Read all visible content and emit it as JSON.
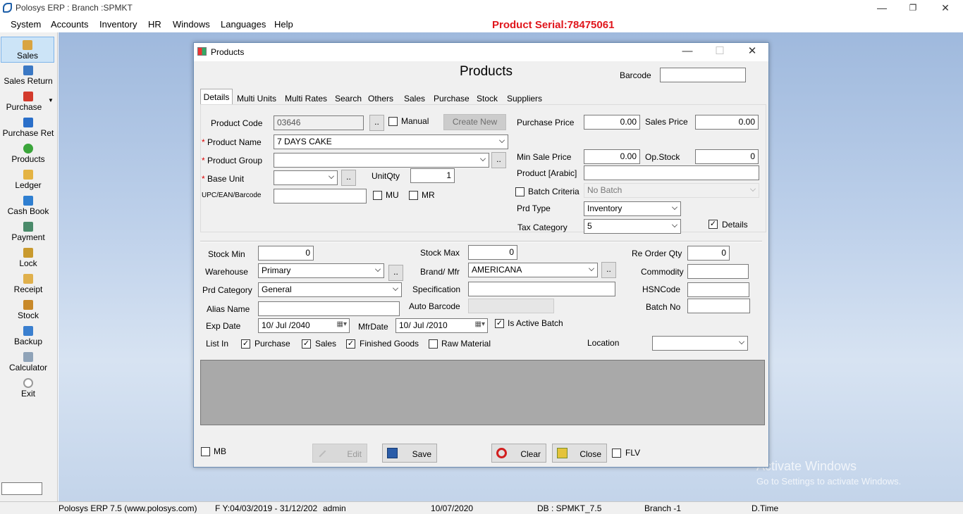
{
  "app": {
    "title": "Polosys ERP :  Branch :SPMKT",
    "serial": "Product Serial:78475061"
  },
  "menu": [
    "System",
    "Accounts",
    "Inventory",
    "HR",
    "Windows",
    "Languages",
    "Help"
  ],
  "sidebar": [
    {
      "label": "Sales",
      "icon": "sales-icon",
      "color": "#d9a441"
    },
    {
      "label": "Sales Return",
      "icon": "sales-return-icon",
      "color": "#3b78c4"
    },
    {
      "label": "Purchase",
      "icon": "purchase-icon",
      "color": "#d33a2c"
    },
    {
      "label": "Purchase Ret",
      "icon": "purchase-return-icon",
      "color": "#2a6fc9"
    },
    {
      "label": "Products",
      "icon": "products-icon",
      "color": "#3aa53a"
    },
    {
      "label": "Ledger",
      "icon": "ledger-icon",
      "color": "#e4b343"
    },
    {
      "label": "Cash Book",
      "icon": "cash-book-icon",
      "color": "#2f7fd1"
    },
    {
      "label": "Payment",
      "icon": "payment-icon",
      "color": "#4a8a6a"
    },
    {
      "label": "Lock",
      "icon": "lock-icon",
      "color": "#c99a2e"
    },
    {
      "label": "Receipt",
      "icon": "receipt-icon",
      "color": "#e0b04c"
    },
    {
      "label": "Stock",
      "icon": "stock-icon",
      "color": "#c8892a"
    },
    {
      "label": "Backup",
      "icon": "backup-icon",
      "color": "#3a7fcf"
    },
    {
      "label": "Calculator",
      "icon": "calculator-icon",
      "color": "#8fa3b8"
    },
    {
      "label": "Exit",
      "icon": "exit-icon",
      "color": "#999999"
    }
  ],
  "status": {
    "app": "Polosys ERP 7.5  (www.polosys.com)",
    "fy": "F Y:04/03/2019 - 31/12/202",
    "user": "admin",
    "date": "10/07/2020",
    "db": "DB : SPMKT_7.5",
    "branch": "Branch -1",
    "time": "D.Time"
  },
  "watermark": {
    "line1": "Activate Windows",
    "line2": "Go to Settings to activate Windows."
  },
  "dialog": {
    "title": "Products",
    "heading": "Products",
    "barcode_label": "Barcode",
    "barcode_value": "",
    "tabs": [
      "Details",
      "Multi Units",
      "Multi Rates",
      "Search",
      "Others",
      "Sales",
      "Purchase",
      "Stock",
      "Suppliers"
    ],
    "product_code_label": "Product Code",
    "product_code": "03646",
    "manual_label": "Manual",
    "create_new": "Create New",
    "product_name_label": "Product Name",
    "product_name": "7 DAYS CAKE",
    "product_group_label": "Product Group",
    "product_group": "",
    "base_unit_label": "Base Unit",
    "base_unit": "",
    "unitqty_label": "UnitQty",
    "unitqty": "1",
    "upc_label": "UPC/EAN/Barcode",
    "upc": "",
    "mu_label": "MU",
    "mr_label": "MR",
    "purchase_price_label": "Purchase Price",
    "purchase_price": "0.00",
    "sales_price_label": "Sales Price",
    "sales_price": "0.00",
    "min_sale_price_label": "Min Sale Price",
    "min_sale_price": "0.00",
    "op_stock_label": "Op.Stock",
    "op_stock": "0",
    "product_arabic_label": "Product [Arabic]",
    "product_arabic": "",
    "batch_criteria_label": "Batch Criteria",
    "batch_criteria": "No Batch",
    "prd_type_label": "Prd Type",
    "prd_type": "Inventory",
    "tax_category_label": "Tax Category",
    "tax_category": "5",
    "details_label": "Details",
    "stock_min_label": "Stock Min",
    "stock_min": "0",
    "stock_max_label": "Stock Max",
    "stock_max": "0",
    "reorder_label": "Re Order Qty",
    "reorder": "0",
    "warehouse_label": "Warehouse",
    "warehouse": "Primary",
    "brand_label": "Brand/ Mfr",
    "brand": "AMERICANA",
    "commodity_label": "Commodity",
    "commodity": "",
    "prd_category_label": "Prd Category",
    "prd_category": "General",
    "specification_label": "Specification",
    "specification": "",
    "hsn_label": "HSNCode",
    "hsn": "",
    "alias_label": "Alias Name",
    "alias": "",
    "auto_barcode_label": "Auto Barcode",
    "auto_barcode": "",
    "batch_no_label": "Batch No",
    "batch_no": "",
    "exp_date_label": "Exp Date",
    "exp_date": "10/ Jul /2040",
    "mfr_date_label": "MfrDate",
    "mfr_date": "10/ Jul /2010",
    "active_batch_label": "Is Active Batch",
    "list_in_label": "List In",
    "list_purchase": "Purchase",
    "list_sales": "Sales",
    "list_finished": "Finished Goods",
    "list_raw": "Raw Material",
    "location_label": "Location",
    "location": "",
    "mb_label": "MB",
    "edit": "Edit",
    "save": "Save",
    "clear": "Clear",
    "close": "Close",
    "flv_label": "FLV"
  }
}
